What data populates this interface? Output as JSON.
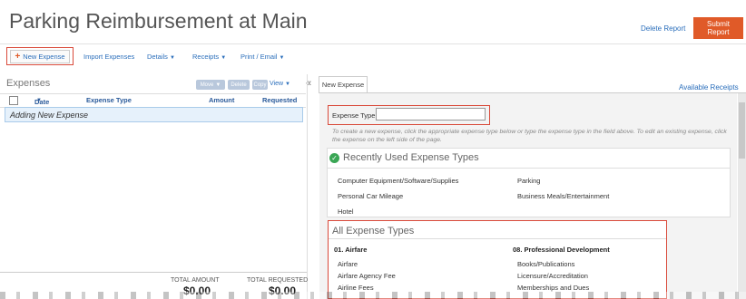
{
  "header": {
    "title": "Parking Reimbursement at Main",
    "delete_label": "Delete Report",
    "submit_label": "Submit Report"
  },
  "toolbar": {
    "new_expense": "New Expense",
    "import": "Import Expenses",
    "details": "Details",
    "receipts": "Receipts",
    "print_email": "Print / Email"
  },
  "left_panel": {
    "heading": "Expenses",
    "buttons": {
      "move": "Move",
      "delete": "Delete",
      "copy": "Copy",
      "view": "View"
    },
    "columns": {
      "date": "Date",
      "expense_type": "Expense Type",
      "amount": "Amount",
      "requested": "Requested"
    },
    "adding_row": "Adding New Expense",
    "totals": {
      "total_amount_label": "TOTAL AMOUNT",
      "total_amount": "$0.00",
      "total_requested_label": "TOTAL REQUESTED",
      "total_requested": "$0.00"
    }
  },
  "right_panel": {
    "tab": "New Expense",
    "available_receipts": "Available Receipts",
    "expense_type_label": "Expense Type",
    "expense_type_value": "",
    "hint": "To create a new expense, click the appropriate expense type below or type the expense type in the field above. To edit an existing expense, click the expense on the left side of the page.",
    "recent": {
      "title": "Recently Used Expense Types",
      "left": [
        "Computer Equipment/Software/Supplies",
        "Personal Car Mileage",
        "Hotel"
      ],
      "right": [
        "Parking",
        "Business Meals/Entertainment"
      ]
    },
    "all": {
      "title": "All Expense Types",
      "col1": {
        "heading": "01. Airfare",
        "items": [
          "Airfare",
          "Airfare Agency Fee",
          "Airline Fees"
        ]
      },
      "col2": {
        "heading": "08. Professional Development",
        "items": [
          "Books/Publications",
          "Licensure/Accreditation",
          "Memberships and Dues"
        ]
      }
    }
  },
  "colors": {
    "accent": "#e05a28",
    "link": "#2a6ebb",
    "highlight_box": "#d94a3a",
    "success": "#3aa655"
  }
}
